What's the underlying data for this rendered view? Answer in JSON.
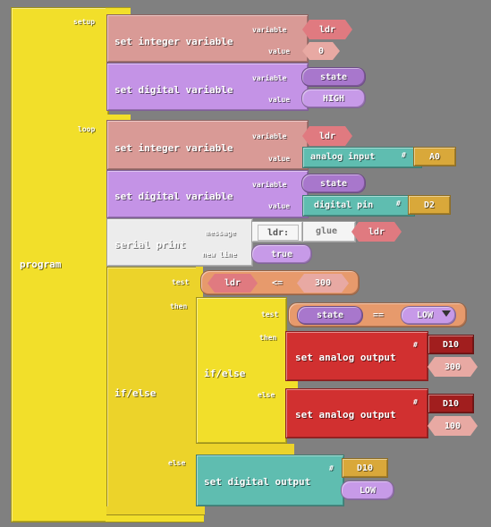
{
  "program": {
    "label": "program",
    "setup_label": "setup",
    "loop_label": "loop"
  },
  "param_labels": {
    "variable": "variable",
    "value": "value",
    "message": "message",
    "new_line": "new line",
    "test": "test",
    "then": "then",
    "else": "else",
    "hash": "#"
  },
  "setup": {
    "set_int": {
      "title": "set integer variable",
      "variable": "ldr",
      "value": "0"
    },
    "set_digital": {
      "title": "set digital variable",
      "variable": "state",
      "value": "HIGH"
    }
  },
  "loop": {
    "set_int": {
      "title": "set integer variable",
      "variable": "ldr",
      "value_block": "analog input",
      "pin": "A0"
    },
    "set_digital": {
      "title": "set digital variable",
      "variable": "state",
      "value_block": "digital pin",
      "pin": "D2"
    },
    "serial_print": {
      "title": "serial print",
      "message_text": "ldr:",
      "glue": "glue",
      "glue_var": "ldr",
      "new_line": "true"
    },
    "if_else": {
      "title": "if/else",
      "test_left": "ldr",
      "test_op": "<=",
      "test_right": "300",
      "inner": {
        "title": "if/else",
        "test_left": "state",
        "test_op": "==",
        "test_right": "LOW",
        "then_block": {
          "title": "set analog output",
          "pin": "D10",
          "value": "300"
        },
        "else_block": {
          "title": "set analog output",
          "pin": "D10",
          "value": "100"
        }
      },
      "else_block": {
        "title": "set digital output",
        "pin": "D10",
        "value": "LOW"
      }
    }
  },
  "colors": {
    "background": "#808080",
    "program": "#f2df2a",
    "integer": "#d99a96",
    "variable_socket": "#e07a80",
    "digital": "#c493e6",
    "serial": "#ececec",
    "analog_input": "#5fbdb0",
    "pin": "#d9a83a",
    "analog_output": "#d13030",
    "pin_dark": "#a11e1e"
  }
}
